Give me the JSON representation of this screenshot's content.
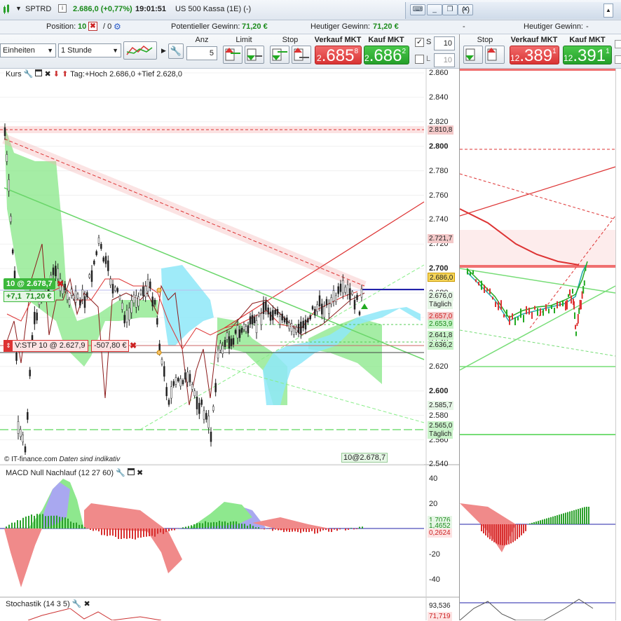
{
  "title_bar": {
    "symbol": "SPTRD",
    "price_change": "2.686,0 (+0,77%)",
    "time": "19:01:51",
    "name": "US 500 Kassa (1E) (-)",
    "right_tab_name": "(-)"
  },
  "info_bar": {
    "position_label": "Position:",
    "position_value": "10",
    "slash_value": "/ 0",
    "potential_gain_label": "Potentieller Gewinn:",
    "potential_gain_value": "71,20 €",
    "today_gain_label": "Heutiger Gewinn:",
    "today_gain_value": "71,20 €",
    "right_dash": "-",
    "right_today_label": "Heutiger Gewinn:",
    "right_today_value": "-"
  },
  "toolbar": {
    "units_select": "Einheiten",
    "interval_select": "1 Stunde",
    "anz_label": "Anz",
    "anz_value": "5",
    "limit_label": "Limit",
    "stop_label": "Stop",
    "sell_label": "Verkauf MKT",
    "buy_label": "Kauf MKT",
    "sell_lead": "2",
    "sell_main": ".685",
    "sell_frac": "8",
    "buy_lead": "2",
    "buy_main": ".686",
    "buy_frac": "2",
    "s_label": "S",
    "s_value": "10",
    "l_label": "L",
    "l_value": "10",
    "right_stop_label": "Stop",
    "right_sell_label": "Verkauf MKT",
    "right_buy_label": "Kauf MKT",
    "right_sell_lead": "12",
    "right_sell_main": ".389",
    "right_sell_frac": "1",
    "right_buy_lead": "12",
    "right_buy_main": ".391",
    "right_buy_frac": "1"
  },
  "chart": {
    "price_panel_label": "Kurs",
    "day_info": "Tag:+Hoch 2.686,0 +Tief 2.628,0",
    "position_tag": "10 @ 2.678,7",
    "position_pts": "+7,1",
    "position_eur": "71,20 €",
    "stop_tag": "V:STP  10 @ 2.627,9",
    "stop_eur": "-507,80 €",
    "watermark": "© IT-finance.com",
    "disclaimer": "Daten sind indikativ",
    "entry_marker": "10@2.678,7",
    "macd_label": "MACD Null Nachlauf (12 27 60)",
    "stoch_label": "Stochastik (14 3 5)",
    "price_ticks": [
      "2.860",
      "2.840",
      "2.820",
      "2.800",
      "2.780",
      "2.760",
      "2.740",
      "2.720",
      "2.700",
      "2.680",
      "2.660",
      "2.640",
      "2.620",
      "2.600",
      "2.580",
      "2.560",
      "2.540"
    ],
    "price_ticks_bold": [
      "2.800",
      "2.700",
      "2.600"
    ],
    "tag_2810": "2.810,8",
    "tag_2721": "2.721,7",
    "tag_2686": "2.686,0",
    "tag_2676": "2.676,0",
    "tag_taeglich1": "Täglich",
    "tag_2657": "2.657,0",
    "tag_2653": "2.653,9",
    "tag_2641": "2.641,8",
    "tag_2636": "2.636,2",
    "tag_2585": "2.585,7",
    "tag_2565": "2.565,0",
    "tag_taeglich2": "Täglich",
    "macd_ticks": [
      "40",
      "20",
      "0",
      "-20",
      "-40"
    ],
    "macd_tag1": "1,7076",
    "macd_tag2": "1,4652",
    "macd_tag3": "0,2624",
    "stoch_tag1": "93,536",
    "stoch_tag2": "71,719"
  },
  "colors": {
    "green_up": "#2aa02a",
    "red_down": "#d83030",
    "cloud_green": "#8ee88e",
    "cloud_blue": "#8ee8f8"
  }
}
